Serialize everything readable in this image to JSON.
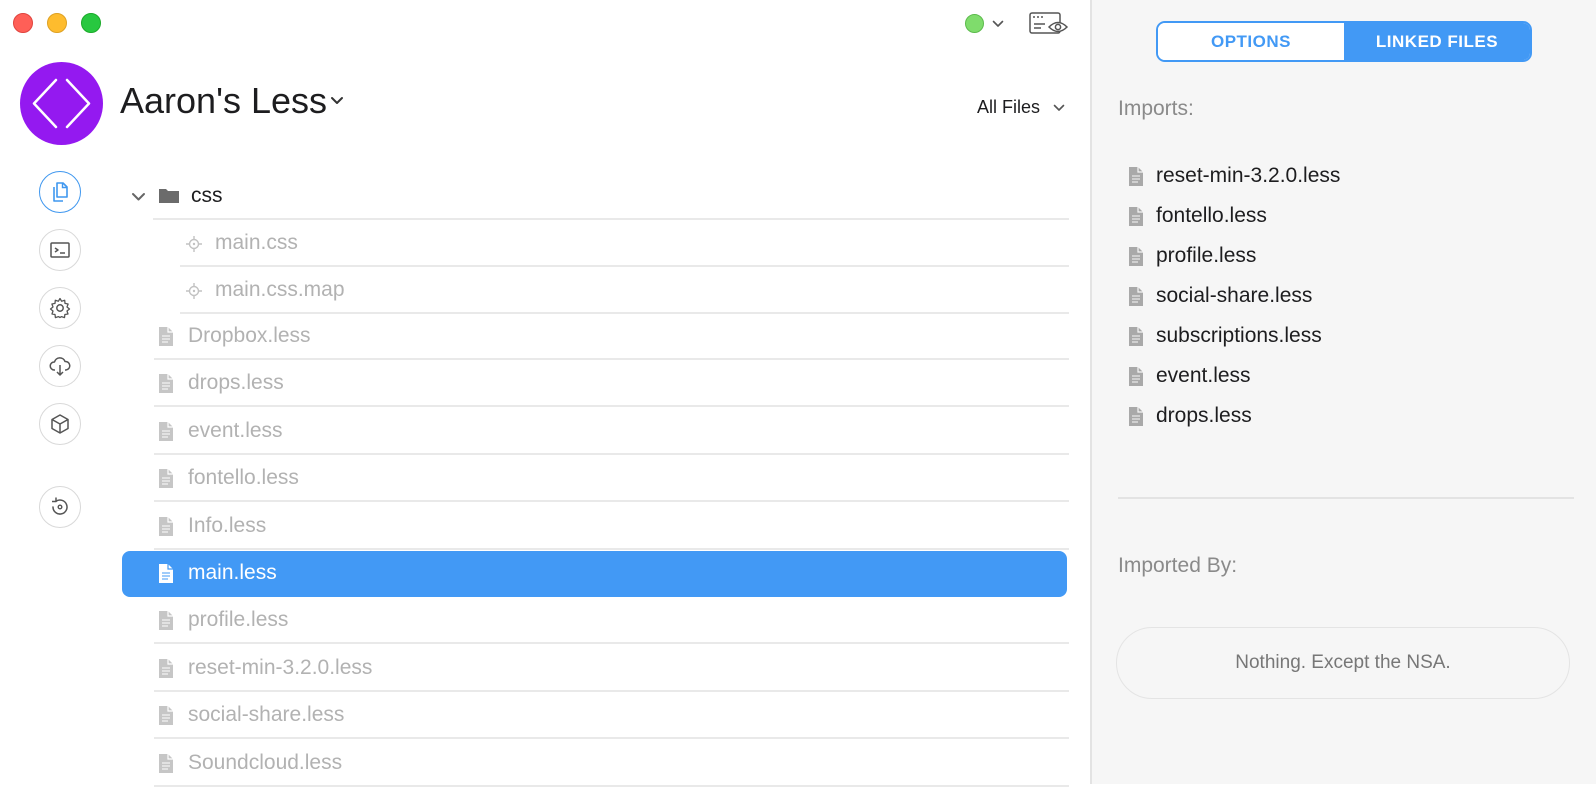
{
  "window": {
    "controls": [
      "close",
      "minimize",
      "zoom"
    ]
  },
  "project": {
    "title": "Aaron's Less",
    "logo_icon": "code-brackets-icon",
    "logo_color": "#9419f0"
  },
  "sidebar": {
    "items": [
      {
        "name": "files",
        "icon": "files-icon",
        "active": true
      },
      {
        "name": "console",
        "icon": "terminal-icon",
        "active": false
      },
      {
        "name": "settings",
        "icon": "gear-icon",
        "active": false
      },
      {
        "name": "deploy",
        "icon": "cloud-download-icon",
        "active": false
      },
      {
        "name": "packages",
        "icon": "box-icon",
        "active": false
      },
      {
        "name": "refresh",
        "icon": "refresh-icon",
        "active": false
      }
    ]
  },
  "toolbar": {
    "status_color": "#7fdc6c",
    "filter_label": "All Files"
  },
  "file_tree": {
    "folder": "css",
    "children": [
      {
        "name": "main.css",
        "icon": "target-icon",
        "muted": true
      },
      {
        "name": "main.css.map",
        "icon": "target-icon",
        "muted": true
      }
    ],
    "files": [
      {
        "name": "Dropbox.less",
        "muted": true,
        "selected": false
      },
      {
        "name": "drops.less",
        "muted": true,
        "selected": false
      },
      {
        "name": "event.less",
        "muted": true,
        "selected": false
      },
      {
        "name": "fontello.less",
        "muted": true,
        "selected": false
      },
      {
        "name": "Info.less",
        "muted": true,
        "selected": false
      },
      {
        "name": "main.less",
        "muted": false,
        "selected": true
      },
      {
        "name": "profile.less",
        "muted": true,
        "selected": false
      },
      {
        "name": "reset-min-3.2.0.less",
        "muted": true,
        "selected": false
      },
      {
        "name": "social-share.less",
        "muted": true,
        "selected": false
      },
      {
        "name": "Soundcloud.less",
        "muted": true,
        "selected": false
      }
    ]
  },
  "inspector": {
    "tabs": [
      {
        "label": "OPTIONS",
        "active": false
      },
      {
        "label": "LINKED FILES",
        "active": true
      }
    ],
    "imports_label": "Imports:",
    "imports": [
      "reset-min-3.2.0.less",
      "fontello.less",
      "profile.less",
      "social-share.less",
      "subscriptions.less",
      "event.less",
      "drops.less"
    ],
    "imported_by_label": "Imported By:",
    "imported_by_empty": "Nothing. Except the NSA.",
    "accent_color": "#4299f5"
  }
}
